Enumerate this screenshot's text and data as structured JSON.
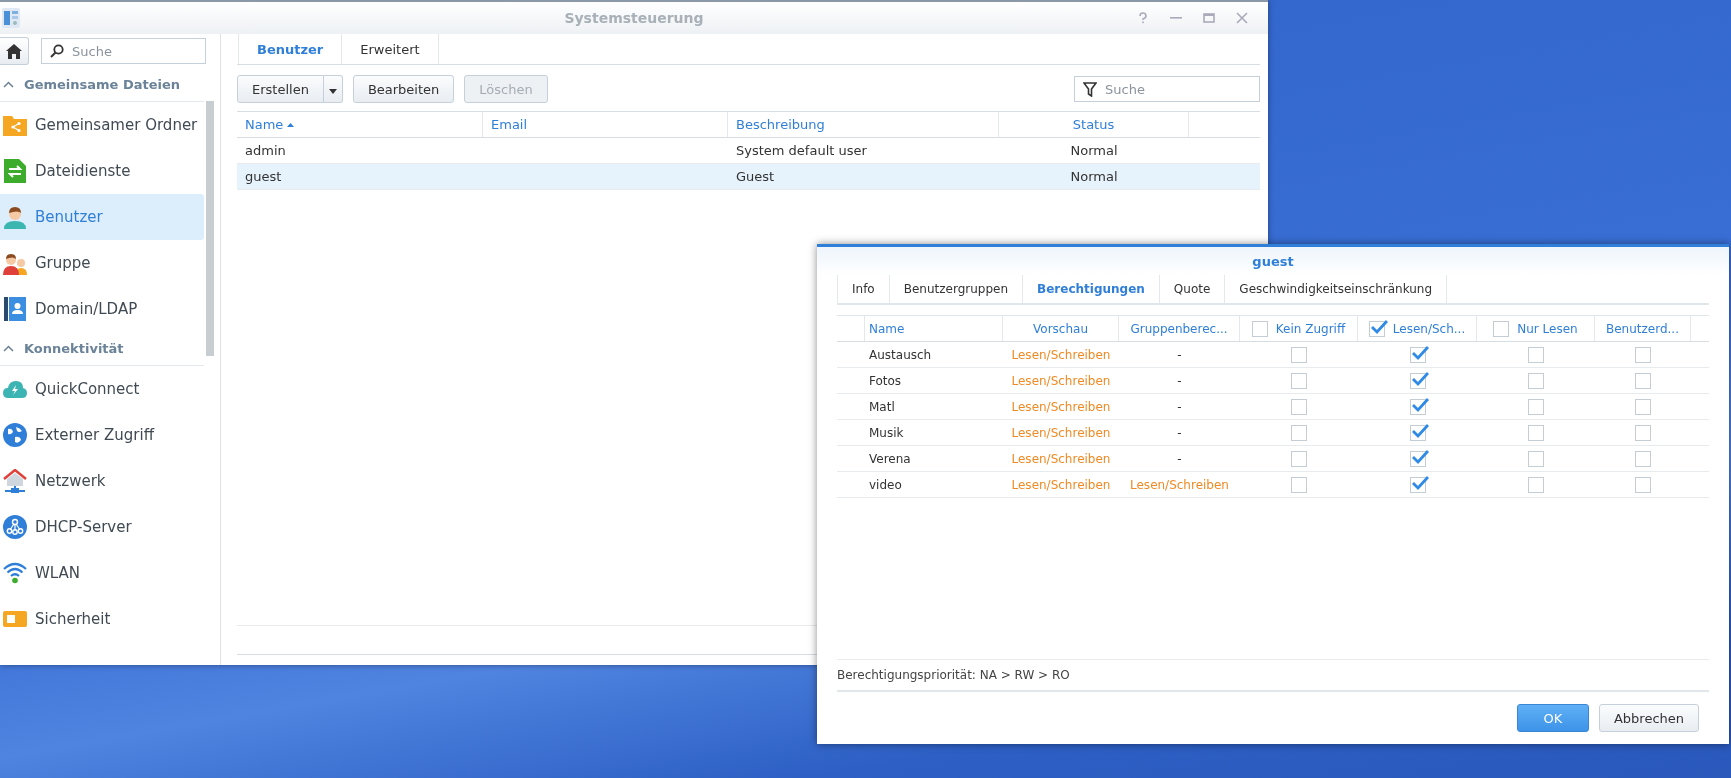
{
  "window": {
    "title": "Systemsteuerung"
  },
  "sidebar": {
    "search": {
      "placeholder": "Suche"
    },
    "sections": [
      {
        "title": "Gemeinsame Dateien",
        "expanded": true,
        "items": [
          {
            "label": "Gemeinsamer Ordner",
            "kind": "folder",
            "selected": false
          },
          {
            "label": "Dateidienste",
            "kind": "file",
            "selected": false
          },
          {
            "label": "Benutzer",
            "kind": "user",
            "selected": true
          },
          {
            "label": "Gruppe",
            "kind": "group",
            "selected": false
          },
          {
            "label": "Domain/LDAP",
            "kind": "book",
            "selected": false
          }
        ]
      },
      {
        "title": "Konnektivität",
        "expanded": true,
        "items": [
          {
            "label": "QuickConnect",
            "kind": "cloud",
            "selected": false
          },
          {
            "label": "Externer Zugriff",
            "kind": "globe",
            "selected": false
          },
          {
            "label": "Netzwerk",
            "kind": "house",
            "selected": false
          },
          {
            "label": "DHCP-Server",
            "kind": "nodes",
            "selected": false
          },
          {
            "label": "WLAN",
            "kind": "wifi",
            "selected": false
          },
          {
            "label": "Sicherheit",
            "kind": "shield",
            "selected": false
          }
        ]
      }
    ]
  },
  "tabs": [
    {
      "label": "Benutzer",
      "selected": true
    },
    {
      "label": "Erweitert",
      "selected": false
    }
  ],
  "toolbar": {
    "buttons": [
      {
        "label": "Erstellen",
        "kind": "split",
        "disabled": false
      },
      {
        "label": "Bearbeiten",
        "kind": "plain",
        "disabled": false
      },
      {
        "label": "Löschen",
        "kind": "plain",
        "disabled": true
      }
    ],
    "search": {
      "placeholder": "Suche"
    }
  },
  "table": {
    "columns": [
      {
        "label": "Name",
        "sorted": true
      },
      {
        "label": "Email",
        "sorted": false
      },
      {
        "label": "Beschreibung",
        "sorted": false
      },
      {
        "label": "Status",
        "sorted": false
      }
    ],
    "rows": [
      {
        "cells": [
          "admin",
          "",
          "System default user",
          "Normal"
        ],
        "selected": false
      },
      {
        "cells": [
          "guest",
          "",
          "Guest",
          "Normal"
        ],
        "selected": true
      }
    ]
  },
  "dialog": {
    "title": "guest",
    "tabs": [
      {
        "label": "Info",
        "selected": false
      },
      {
        "label": "Benutzergruppen",
        "selected": false
      },
      {
        "label": "Berechtigungen",
        "selected": true
      },
      {
        "label": "Quote",
        "selected": false
      },
      {
        "label": "Geschwindigkeitseinschränkung",
        "selected": false
      }
    ],
    "columns": [
      {
        "label": "Name",
        "kind": "text"
      },
      {
        "label": "Vorschau",
        "kind": "text"
      },
      {
        "label": "Gruppenberec...",
        "kind": "text"
      },
      {
        "label": "Kein Zugriff",
        "kind": "check",
        "checked": false
      },
      {
        "label": "Lesen/Sch...",
        "kind": "check",
        "checked": true
      },
      {
        "label": "Nur Lesen",
        "kind": "check",
        "checked": false
      },
      {
        "label": "Benutzerd...",
        "kind": "text"
      }
    ],
    "rows": [
      {
        "name": "Austausch",
        "preview": "Lesen/Schreiben",
        "group": {
          "text": "-",
          "kind": "none"
        },
        "checks": [
          false,
          true,
          false,
          false
        ]
      },
      {
        "name": "Fotos",
        "preview": "Lesen/Schreiben",
        "group": {
          "text": "-",
          "kind": "none"
        },
        "checks": [
          false,
          true,
          false,
          false
        ]
      },
      {
        "name": "Matl",
        "preview": "Lesen/Schreiben",
        "group": {
          "text": "-",
          "kind": "none"
        },
        "checks": [
          false,
          true,
          false,
          false
        ]
      },
      {
        "name": "Musik",
        "preview": "Lesen/Schreiben",
        "group": {
          "text": "-",
          "kind": "none"
        },
        "checks": [
          false,
          true,
          false,
          false
        ]
      },
      {
        "name": "Verena",
        "preview": "Lesen/Schreiben",
        "group": {
          "text": "-",
          "kind": "none"
        },
        "checks": [
          false,
          true,
          false,
          false
        ]
      },
      {
        "name": "video",
        "preview": "Lesen/Schreiben",
        "group": {
          "text": "Lesen/Schreiben",
          "kind": "permission"
        },
        "checks": [
          false,
          true,
          false,
          false
        ]
      }
    ],
    "note": "Berechtigungspriorität: NA > RW > RO",
    "buttons": [
      {
        "label": "OK",
        "primary": true
      },
      {
        "label": "Abbrechen",
        "primary": false
      }
    ]
  }
}
